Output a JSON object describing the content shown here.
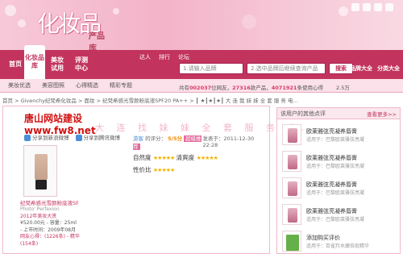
{
  "logo": {
    "main": "化妆品",
    "sub": "产品库"
  },
  "nav": {
    "items": [
      {
        "label": "首页"
      },
      {
        "label": "化妆品库"
      },
      {
        "label": "美妆试用"
      },
      {
        "label": "评测中心"
      }
    ],
    "sub_links": [
      "达人",
      "排行",
      "论坛"
    ],
    "search_placeholder_1": "1.请输入品牌",
    "search_placeholder_2": "2.选中品牌后继续查询产品",
    "search_button": "搜索",
    "brand_links": [
      "品牌大全",
      "分类大全"
    ]
  },
  "bar3": {
    "links": [
      "美妆优选",
      "美容图照",
      "心得精选",
      "精彩专题"
    ],
    "stats_prefix": "共有",
    "stats_n1": "002037",
    "stats_mid1": "位网友，",
    "stats_n2": "27316",
    "stats_mid2": "款产品，",
    "stats_n3": "4071921",
    "stats_suffix": "条使用心得",
    "stats_tail": "2.5万"
  },
  "breadcrumb": "首页 > Givenchy纪梵希化妆品 > 面妆 > 纪梵希感光雪颜粉底液SPF20 PA++ > ┃ ★┃★┃★┃ 大 连 我 妹 妹 全 套 服 务 电...",
  "watermark": {
    "line1": "唐山网站建设",
    "line2": "www.fw8.net"
  },
  "promo_text": "大 连 找 妹 妹 全 套 服 务 电...",
  "share": {
    "a": "分享到新浪微博",
    "b": "分享到腾讯微博"
  },
  "product": {
    "name": "纪梵希感光雪颜粉底液SF",
    "subname": "Photo' Perfexion",
    "promo": "2012年美妆大赏",
    "price": "¥520.00元 - 容量：25ml",
    "date": "- 上市时间：2009年08月",
    "reviews": "网友心得：(1226条) - 精华 (154条)"
  },
  "review": {
    "user": "游客",
    "score_label": "的评分：",
    "score": "5/5分",
    "rec": "超级推荐",
    "date": "发表于：2011-12-30 22:28",
    "rows": [
      {
        "label": "自然度",
        "stars": "★★★★★",
        "label2": "清爽度",
        "stars2": "★★★★★"
      },
      {
        "label": "性价比",
        "stars": "★★★★★"
      }
    ]
  },
  "sidebar": {
    "title": "该用户的其他点评",
    "more": "查看更多>>",
    "items": [
      {
        "title": "欧莱雅弦亮凝养唇膏",
        "desc": "适用于：巴黎欧莱雅弦亮凝"
      },
      {
        "title": "欧莱雅弦亮凝养唇膏",
        "desc": "适用于：巴黎欧莱雅弦亮凝"
      },
      {
        "title": "欧莱雅弦亮凝养唇膏",
        "desc": "适用于：巴黎欧莱雅弦亮凝"
      },
      {
        "title": "欧莱雅弦亮凝养唇膏",
        "desc": "适用于：巴黎欧莱雅弦亮凝"
      },
      {
        "title": "添加购买评价",
        "desc": "适用于：百雀羚水嫩倍现精华"
      }
    ]
  },
  "colors": {
    "brand": "#c2345e",
    "pink_bg": "#fbe1e9",
    "accent_red": "#d01010"
  }
}
